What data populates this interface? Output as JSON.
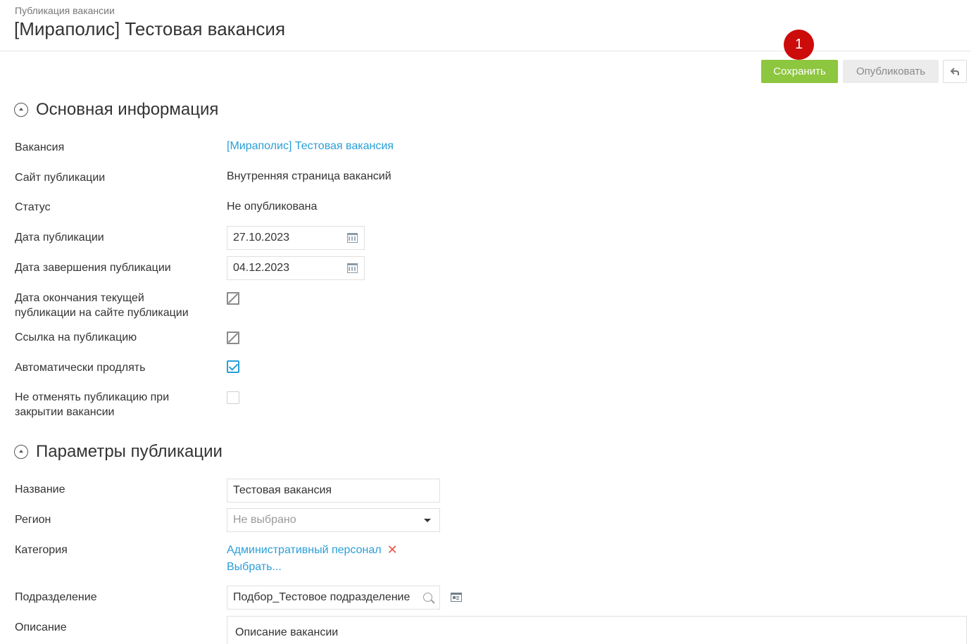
{
  "header": {
    "breadcrumb": "Публикация вакансии",
    "title": "[Мираполис] Тестовая вакансия"
  },
  "toolbar": {
    "save_label": "Сохранить",
    "publish_label": "Опубликовать",
    "step_marker": "1"
  },
  "main_info": {
    "section_title": "Основная информация",
    "vacancy_label": "Вакансия",
    "vacancy_value": "[Мираполис] Тестовая вакансия",
    "site_label": "Сайт публикации",
    "site_value": "Внутренняя страница вакансий",
    "status_label": "Статус",
    "status_value": "Не опубликована",
    "pub_date_label": "Дата публикации",
    "pub_date_value": "27.10.2023",
    "end_date_label": "Дата завершения публикации",
    "end_date_value": "04.12.2023",
    "site_end_label_line1": "Дата окончания текущей",
    "site_end_label_line2": "публикации на сайте публикации",
    "link_label": "Ссылка на публикацию",
    "auto_extend_label": "Автоматически продлять",
    "auto_extend_checked": true,
    "no_cancel_label_line1": "Не отменять публикацию при",
    "no_cancel_label_line2": "закрытии вакансии",
    "no_cancel_checked": false
  },
  "pub_params": {
    "section_title": "Параметры публикации",
    "name_label": "Название",
    "name_value": "Тестовая вакансия",
    "region_label": "Регион",
    "region_placeholder": "Не выбрано",
    "category_label": "Категория",
    "category_value": "Административный персонал",
    "category_choose": "Выбрать...",
    "department_label": "Подразделение",
    "department_value": "Подбор_Тестовое подразделение",
    "description_label": "Описание",
    "description_value": "Описание вакансии"
  },
  "colors": {
    "save_button": "#8dc63f",
    "link": "#2a9fd8",
    "marker": "#cc0b0b",
    "remove": "#e8574a"
  }
}
